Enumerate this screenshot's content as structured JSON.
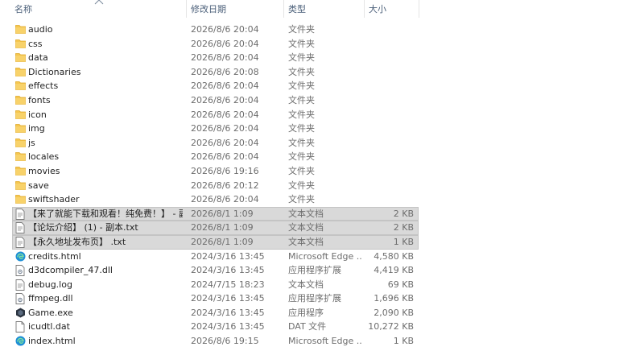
{
  "columns": {
    "name": "名称",
    "modified": "修改日期",
    "type": "类型",
    "size": "大小"
  },
  "icon_names": {
    "folder": "folder-icon",
    "txt": "text-file-icon",
    "edge": "edge-html-icon",
    "dll": "dll-file-icon",
    "log": "log-file-icon",
    "exe": "game-exe-icon",
    "dat": "dat-file-icon"
  },
  "files": [
    {
      "name": "audio",
      "modified": "2026/8/6 20:04",
      "type": "文件夹",
      "size": "",
      "icon": "folder",
      "selected": false
    },
    {
      "name": "css",
      "modified": "2026/8/6 20:04",
      "type": "文件夹",
      "size": "",
      "icon": "folder",
      "selected": false
    },
    {
      "name": "data",
      "modified": "2026/8/6 20:04",
      "type": "文件夹",
      "size": "",
      "icon": "folder",
      "selected": false
    },
    {
      "name": "Dictionaries",
      "modified": "2026/8/6 20:08",
      "type": "文件夹",
      "size": "",
      "icon": "folder",
      "selected": false
    },
    {
      "name": "effects",
      "modified": "2026/8/6 20:04",
      "type": "文件夹",
      "size": "",
      "icon": "folder",
      "selected": false
    },
    {
      "name": "fonts",
      "modified": "2026/8/6 20:04",
      "type": "文件夹",
      "size": "",
      "icon": "folder",
      "selected": false
    },
    {
      "name": "icon",
      "modified": "2026/8/6 20:04",
      "type": "文件夹",
      "size": "",
      "icon": "folder",
      "selected": false
    },
    {
      "name": "img",
      "modified": "2026/8/6 20:04",
      "type": "文件夹",
      "size": "",
      "icon": "folder",
      "selected": false
    },
    {
      "name": "js",
      "modified": "2026/8/6 20:04",
      "type": "文件夹",
      "size": "",
      "icon": "folder",
      "selected": false
    },
    {
      "name": "locales",
      "modified": "2026/8/6 20:04",
      "type": "文件夹",
      "size": "",
      "icon": "folder",
      "selected": false
    },
    {
      "name": "movies",
      "modified": "2026/8/6 19:16",
      "type": "文件夹",
      "size": "",
      "icon": "folder",
      "selected": false
    },
    {
      "name": "save",
      "modified": "2026/8/6 20:12",
      "type": "文件夹",
      "size": "",
      "icon": "folder",
      "selected": false
    },
    {
      "name": "swiftshader",
      "modified": "2026/8/6 20:04",
      "type": "文件夹",
      "size": "",
      "icon": "folder",
      "selected": false
    },
    {
      "name": "【来了就能下载和观看！纯免费！】 - 副...",
      "modified": "2026/8/1 1:09",
      "type": "文本文档",
      "size": "2 KB",
      "icon": "txt",
      "selected": true
    },
    {
      "name": "【论坛介绍】 (1) - 副本.txt",
      "modified": "2026/8/1 1:09",
      "type": "文本文档",
      "size": "2 KB",
      "icon": "txt",
      "selected": true
    },
    {
      "name": "【永久地址发布页】 .txt",
      "modified": "2026/8/1 1:09",
      "type": "文本文档",
      "size": "1 KB",
      "icon": "txt",
      "selected": true
    },
    {
      "name": "credits.html",
      "modified": "2024/3/16 13:45",
      "type": "Microsoft Edge ...",
      "size": "4,580 KB",
      "icon": "edge",
      "selected": false
    },
    {
      "name": "d3dcompiler_47.dll",
      "modified": "2024/3/16 13:45",
      "type": "应用程序扩展",
      "size": "4,419 KB",
      "icon": "dll",
      "selected": false
    },
    {
      "name": "debug.log",
      "modified": "2024/7/15 18:23",
      "type": "文本文档",
      "size": "69 KB",
      "icon": "log",
      "selected": false
    },
    {
      "name": "ffmpeg.dll",
      "modified": "2024/3/16 13:45",
      "type": "应用程序扩展",
      "size": "1,696 KB",
      "icon": "dll",
      "selected": false
    },
    {
      "name": "Game.exe",
      "modified": "2024/3/16 13:45",
      "type": "应用程序",
      "size": "2,090 KB",
      "icon": "exe",
      "selected": false
    },
    {
      "name": "icudtl.dat",
      "modified": "2024/3/16 13:45",
      "type": "DAT 文件",
      "size": "10,272 KB",
      "icon": "dat",
      "selected": false
    },
    {
      "name": "index.html",
      "modified": "2026/8/6 19:15",
      "type": "Microsoft Edge ...",
      "size": "1 KB",
      "icon": "edge",
      "selected": false
    }
  ],
  "colors": {
    "header_text": "#4c607a",
    "folder": "#f3c34a",
    "selection": "#d9d9d9"
  }
}
